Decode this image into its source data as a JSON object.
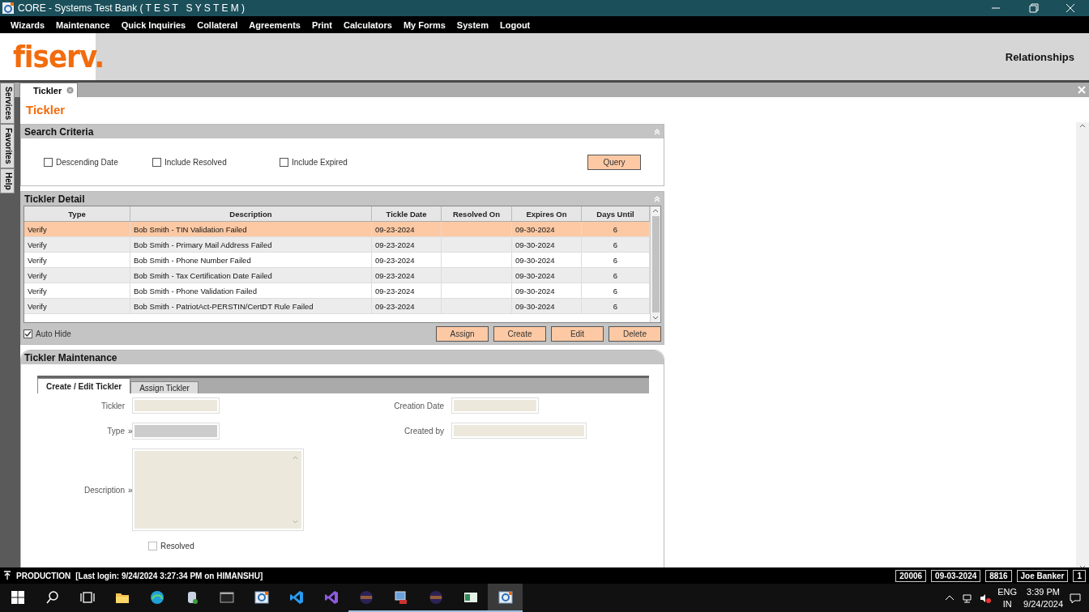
{
  "window": {
    "title": "CORE - Systems Test Bank ( T E S T   S Y S T E M )"
  },
  "menu": [
    "Wizards",
    "Maintenance",
    "Quick Inquiries",
    "Collateral",
    "Agreements",
    "Print",
    "Calculators",
    "My Forms",
    "System",
    "Logout"
  ],
  "header": {
    "logo": "fiserv.",
    "title": "Relationships"
  },
  "side_tabs": [
    "Services",
    "Favorites",
    "Help"
  ],
  "doc_tabs": [
    {
      "label": "Tickler",
      "selected": true
    }
  ],
  "page_title": "Tickler",
  "search_criteria": {
    "title": "Search Criteria",
    "checkboxes": [
      {
        "label": "Descending Date",
        "checked": false
      },
      {
        "label": "Include Resolved",
        "checked": false
      },
      {
        "label": "Include Expired",
        "checked": false
      }
    ],
    "button": "Query"
  },
  "tickler_detail": {
    "title": "Tickler Detail",
    "columns": [
      "Type",
      "Description",
      "Tickle Date",
      "Resolved On",
      "Expires On",
      "Days Until"
    ],
    "rows": [
      {
        "cells": [
          "Verify",
          "Bob Smith - TIN Validation Failed",
          "09-23-2024",
          "",
          "09-30-2024",
          "6"
        ],
        "selected": true
      },
      {
        "cells": [
          "Verify",
          "Bob Smith - Primary Mail Address Failed",
          "09-23-2024",
          "",
          "09-30-2024",
          "6"
        ],
        "selected": false
      },
      {
        "cells": [
          "Verify",
          "Bob Smith - Phone Number Failed",
          "09-23-2024",
          "",
          "09-30-2024",
          "6"
        ],
        "selected": false
      },
      {
        "cells": [
          "Verify",
          "Bob Smith - Tax Certification Date Failed",
          "09-23-2024",
          "",
          "09-30-2024",
          "6"
        ],
        "selected": false
      },
      {
        "cells": [
          "Verify",
          "Bob Smith - Phone Validation Failed",
          "09-23-2024",
          "",
          "09-30-2024",
          "6"
        ],
        "selected": false
      },
      {
        "cells": [
          "Verify",
          "Bob Smith - PatriotAct-PERSTIN/CertDT Rule Failed",
          "09-23-2024",
          "",
          "09-30-2024",
          "6"
        ],
        "selected": false
      }
    ],
    "auto_hide": {
      "label": "Auto Hide",
      "checked": true
    },
    "buttons": [
      "Assign",
      "Create",
      "Edit",
      "Delete"
    ]
  },
  "maintenance": {
    "title": "Tickler Maintenance",
    "tabs": [
      {
        "label": "Create / Edit Tickler",
        "selected": true
      },
      {
        "label": "Assign Tickler",
        "selected": false
      }
    ],
    "left_fields": [
      {
        "label": "Tickler",
        "kind": "text"
      },
      {
        "label": "Type",
        "kind": "select",
        "marker": "»"
      },
      {
        "label": "Description",
        "kind": "textarea",
        "marker": "»"
      }
    ],
    "right_fields": [
      {
        "label": "Creation Date",
        "kind": "text"
      },
      {
        "label": "Created by",
        "kind": "wide"
      }
    ],
    "resolved": {
      "label": "Resolved",
      "checked": false
    }
  },
  "status_bar": {
    "environment": "PRODUCTION",
    "login": "[Last login: 9/24/2024 3:27:34 PM on HIMANSHU]",
    "cells": [
      "20006",
      "09-03-2024",
      "8816",
      "Joe Banker",
      "1"
    ]
  },
  "taskbar": {
    "apps": [
      {
        "kind": "start",
        "running": false,
        "selected": false
      },
      {
        "kind": "search",
        "running": false,
        "selected": false
      },
      {
        "kind": "taskview",
        "running": false,
        "selected": false
      },
      {
        "kind": "folder",
        "running": false,
        "selected": false
      },
      {
        "kind": "browser",
        "running": false,
        "selected": false
      },
      {
        "kind": "database",
        "running": false,
        "selected": false
      },
      {
        "kind": "terminal",
        "running": false,
        "selected": false
      },
      {
        "kind": "core",
        "running": false,
        "selected": false
      },
      {
        "kind": "code",
        "running": false,
        "selected": false
      },
      {
        "kind": "studio",
        "running": false,
        "selected": false
      },
      {
        "kind": "eclipse",
        "running": true,
        "selected": false
      },
      {
        "kind": "monitor",
        "running": true,
        "selected": false
      },
      {
        "kind": "eclipse",
        "running": true,
        "selected": false
      },
      {
        "kind": "sheet",
        "running": true,
        "selected": false
      },
      {
        "kind": "core",
        "running": true,
        "selected": true
      }
    ],
    "language": [
      "ENG",
      "IN"
    ],
    "time": "3:39 PM",
    "date": "9/24/2024"
  }
}
